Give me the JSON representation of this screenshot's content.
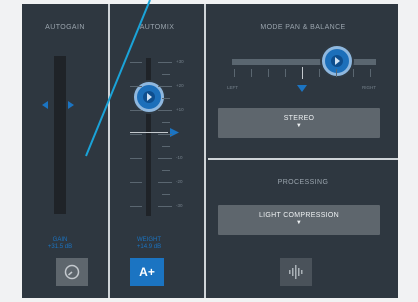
{
  "autogain": {
    "title": "AUTOGAIN",
    "gain_label": "GAIN",
    "gain_value": "+31.5 dB",
    "meter_icon": "dial-icon"
  },
  "automix": {
    "title": "AUTOMIX",
    "scale": [
      "+30",
      "+20",
      "+10",
      "",
      "-10",
      "-20",
      "-30"
    ],
    "weight_label": "WEIGHT",
    "weight_value": "+14.9 dB",
    "aplus_label": "A+"
  },
  "mode": {
    "title": "MODE PAN & BALANCE",
    "left_label": "LEFT",
    "right_label": "RIGHT",
    "selected": "STEREO",
    "caret": "▼"
  },
  "processing": {
    "title": "PROCESSING",
    "selected": "LIGHT COMPRESSION",
    "caret": "▼",
    "icon": "waveform-icon"
  },
  "colors": {
    "accent": "#1b74c2",
    "panel_bg": "#2e3740",
    "button_gray": "#5e666d"
  }
}
